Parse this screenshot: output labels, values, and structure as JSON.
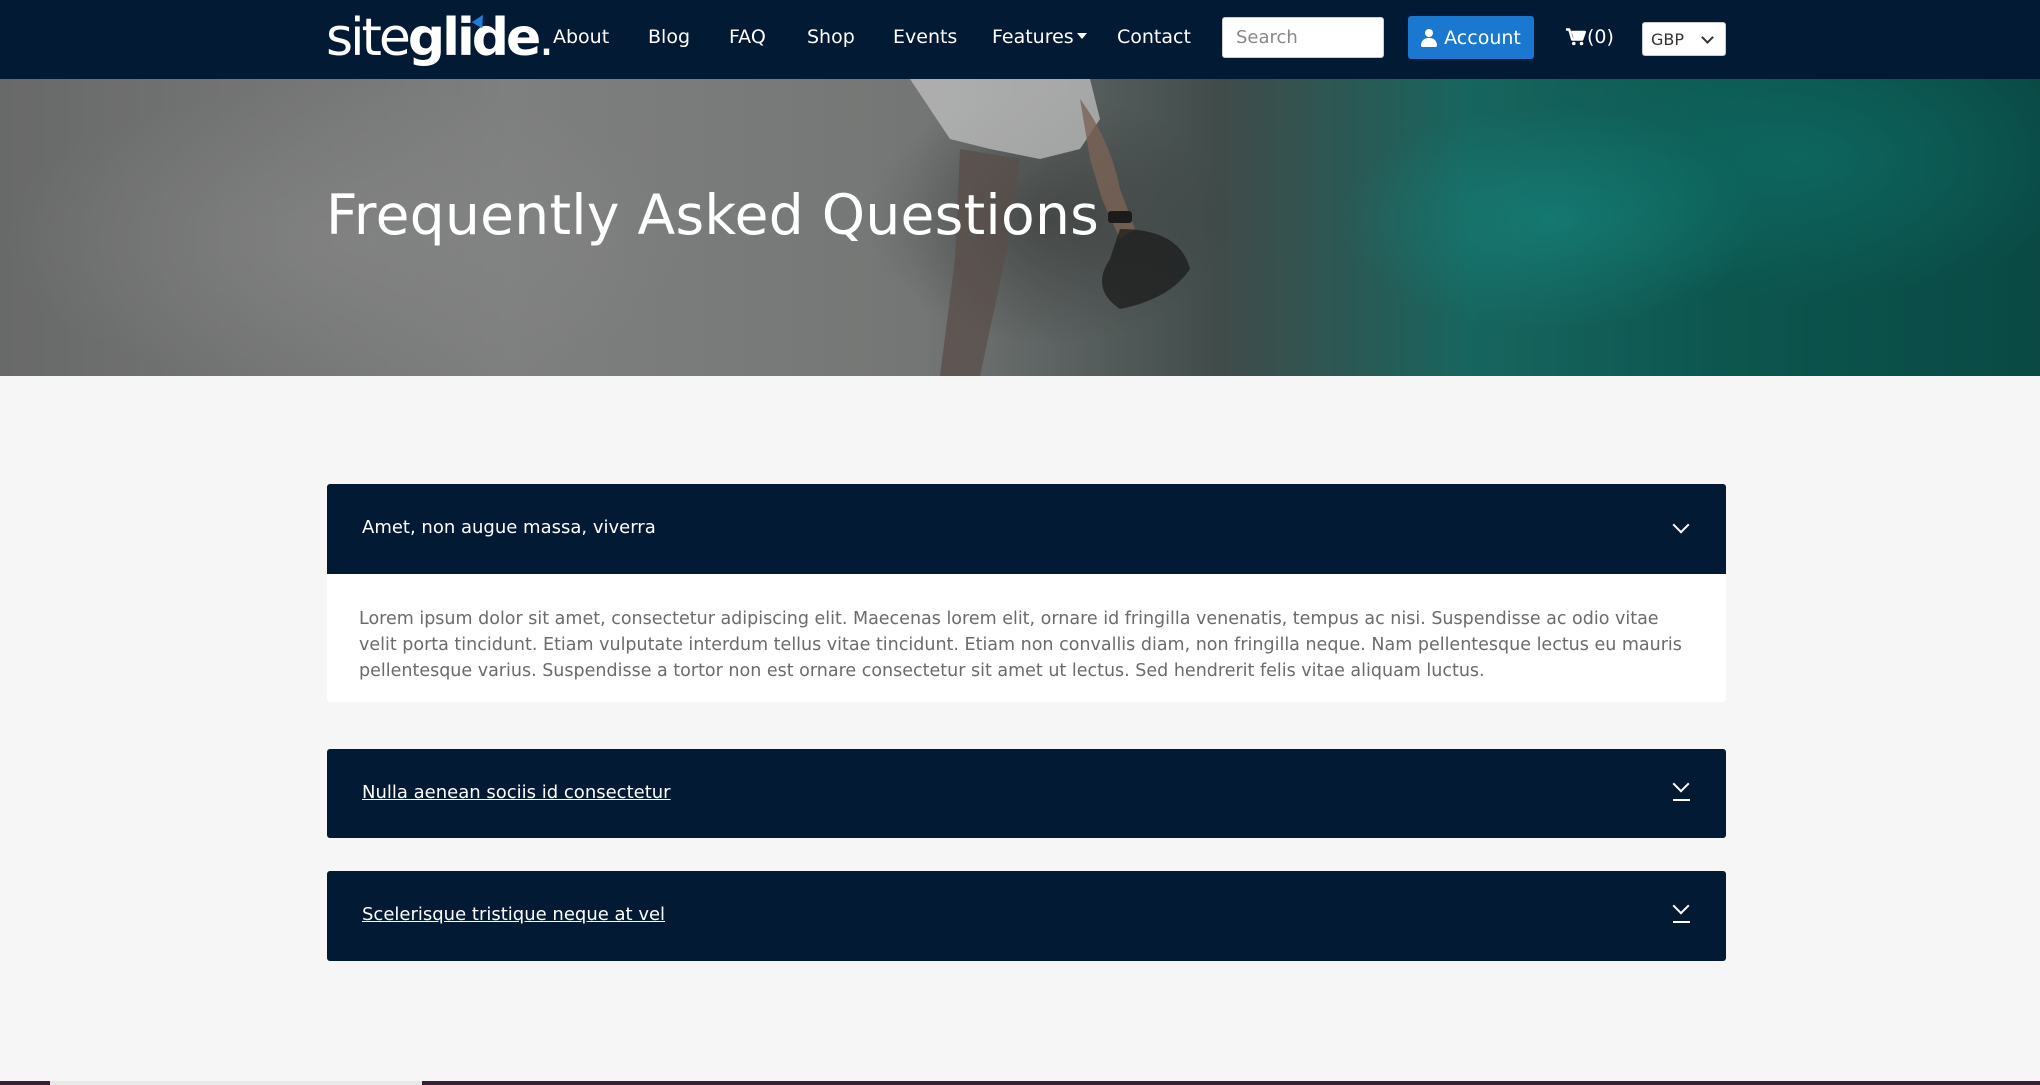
{
  "brand": {
    "logo_site": "site",
    "logo_glide": "glide",
    "logo_dot": "."
  },
  "nav": {
    "links": [
      {
        "label": "About"
      },
      {
        "label": "Blog"
      },
      {
        "label": "FAQ"
      },
      {
        "label": "Shop"
      },
      {
        "label": "Events"
      },
      {
        "label": "Features"
      },
      {
        "label": "Contact"
      }
    ],
    "search_placeholder": "Search",
    "account_label": "Account",
    "cart_label": "(0)",
    "currency": "GBP"
  },
  "hero": {
    "title": "Frequently Asked Questions"
  },
  "faq": [
    {
      "question": "Amet, non augue massa, viverra",
      "answer": "Lorem ipsum dolor sit amet, consectetur adipiscing elit. Maecenas lorem elit, ornare id fringilla venenatis, tempus ac nisi. Suspendisse ac odio vitae velit porta tincidunt. Etiam vulputate interdum tellus vitae tincidunt. Etiam non convallis diam, non fringilla neque. Nam pellentesque lectus eu mauris pellentesque varius. Suspendisse a tortor non est ornare consectetur sit amet ut lectus. Sed hendrerit felis vitae aliquam luctus.",
      "expanded": true
    },
    {
      "question": "Nulla aenean sociis id consectetur",
      "expanded": false
    },
    {
      "question": "Scelerisque tristique neque at vel",
      "expanded": false
    }
  ],
  "colors": {
    "nav_bg": "#021a33",
    "accent": "#1a78d1",
    "page_bg": "#f6f6f6"
  }
}
